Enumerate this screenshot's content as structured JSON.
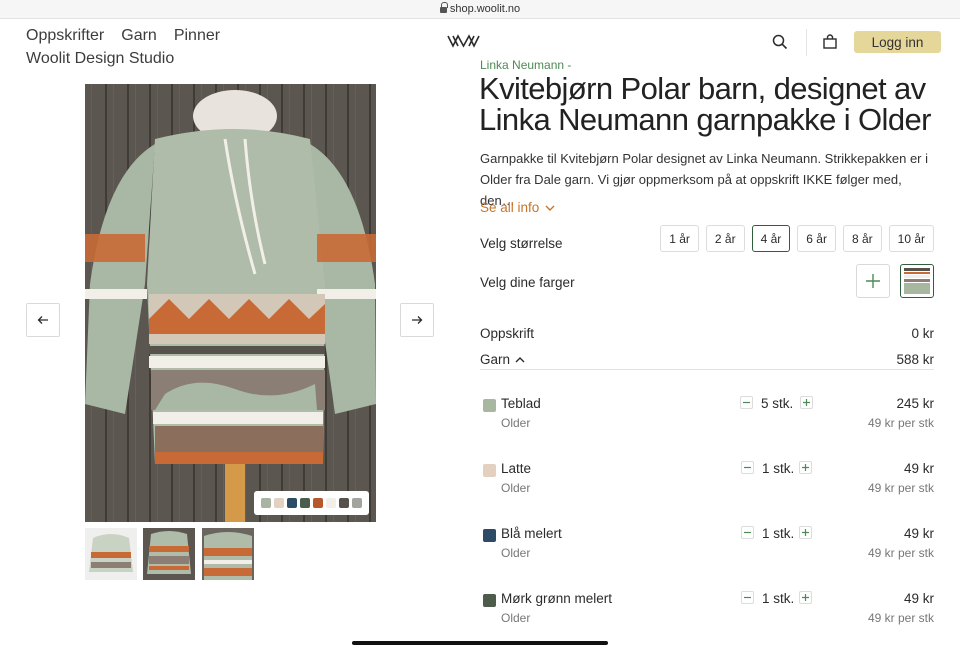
{
  "browser": {
    "url": "shop.woolit.no"
  },
  "nav": {
    "items": [
      "Oppskrifter",
      "Garn",
      "Pinner"
    ],
    "studio": "Woolit Design Studio"
  },
  "header": {
    "login_label": "Logg inn"
  },
  "product": {
    "designer": "Linka Neumann -",
    "title": "Kvitebjørn Polar barn, designet av Linka Neumann garnpakke i Older",
    "description": "Garnpakke til Kvitebjørn Polar designet av Linka Neumann. Strikkepakken er i Older fra Dale garn. Vi gjør oppmerksom på at oppskrift IKKE følger med, den…",
    "see_all": "Se all info",
    "size_label": "Velg størrelse",
    "sizes": [
      "1 år",
      "2 år",
      "4 år",
      "6 år",
      "8 år",
      "10 år"
    ],
    "selected_size": "4 år",
    "color_label": "Velg dine farger"
  },
  "gallery": {
    "swatches": [
      "#a8b3a1",
      "#e2d2c2",
      "#2c4b66",
      "#4c5c4d",
      "#b8572b",
      "#f2efe8",
      "#56514b",
      "#a3a49e"
    ]
  },
  "pricing": {
    "pattern_label": "Oppskrift",
    "pattern_price": "0 kr",
    "yarn_label": "Garn",
    "yarn_price": "588 kr"
  },
  "yarns": [
    {
      "name": "Teblad",
      "sub": "Older",
      "qty": "5 stk.",
      "price": "245 kr",
      "per": "49 kr per stk",
      "color": "#a8b8a0"
    },
    {
      "name": "Latte",
      "sub": "Older",
      "qty": "1 stk.",
      "price": "49 kr",
      "per": "49 kr per stk",
      "color": "#e3d0c0"
    },
    {
      "name": "Blå melert",
      "sub": "Older",
      "qty": "1 stk.",
      "price": "49 kr",
      "per": "49 kr per stk",
      "color": "#2d4a67"
    },
    {
      "name": "Mørk grønn melert",
      "sub": "Older",
      "qty": "1 stk.",
      "price": "49 kr",
      "per": "49 kr per stk",
      "color": "#4d5c4b"
    }
  ],
  "colors": {
    "accent": "#c7752c",
    "login_bg": "#e5d79a",
    "selected_border": "#2f5e3a",
    "designer": "#4e8a55"
  }
}
